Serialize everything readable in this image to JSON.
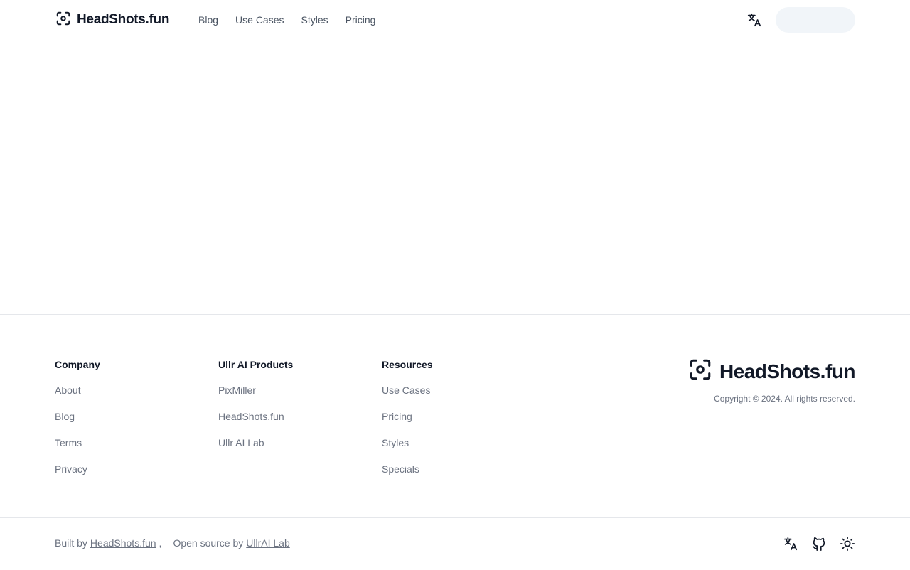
{
  "header": {
    "brand": "HeadShots.fun",
    "nav": [
      {
        "label": "Blog"
      },
      {
        "label": "Use Cases"
      },
      {
        "label": "Styles"
      },
      {
        "label": "Pricing"
      }
    ],
    "language_icon": "translate-icon"
  },
  "footer": {
    "columns": [
      {
        "title": "Company",
        "links": [
          "About",
          "Blog",
          "Terms",
          "Privacy"
        ]
      },
      {
        "title": "Ullr AI Products",
        "links": [
          "PixMiller",
          "HeadShots.fun",
          "Ullr AI Lab"
        ]
      },
      {
        "title": "Resources",
        "links": [
          "Use Cases",
          "Pricing",
          "Styles",
          "Specials"
        ]
      }
    ],
    "brand": "HeadShots.fun",
    "copyright": "Copyright © 2024. All rights reserved.",
    "credits": {
      "built_by_prefix": "Built by",
      "built_by_link": "HeadShots.fun",
      "separator": ",",
      "open_source_prefix": "Open source by",
      "open_source_link": "UllrAI Lab"
    },
    "icons": [
      "translate-icon",
      "github-icon",
      "sun-icon"
    ]
  },
  "colors": {
    "text": "#111827",
    "muted": "#6b7280",
    "border": "#e5e7eb",
    "skeleton": "#f1f5f9"
  }
}
